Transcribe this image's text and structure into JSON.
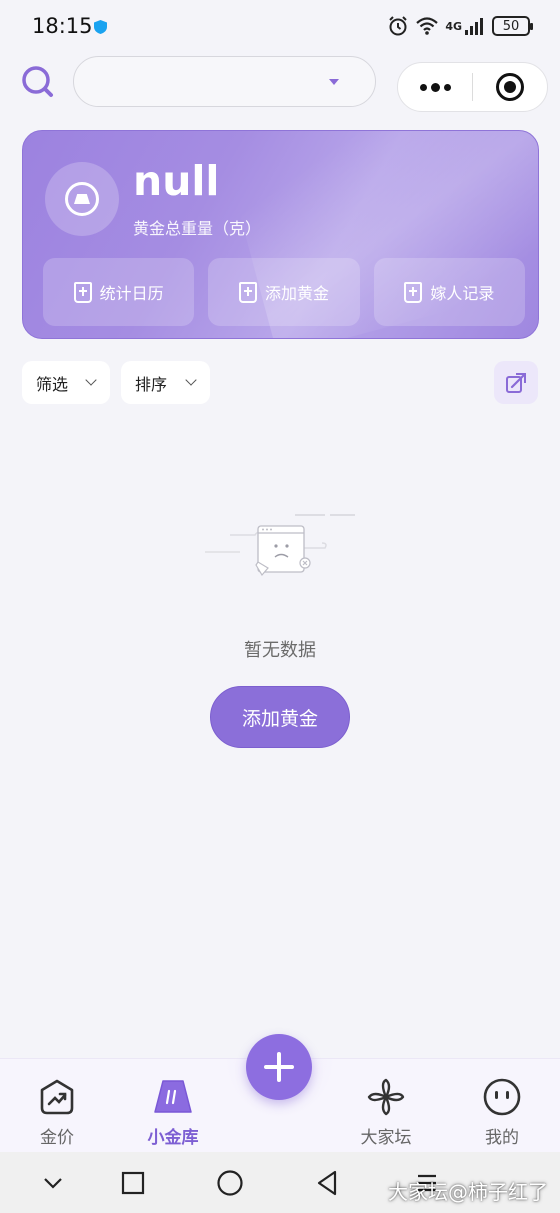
{
  "status_bar": {
    "time": "18:15",
    "network": "4G",
    "battery": "50"
  },
  "header": {
    "select_value": "",
    "icons": [
      "search-icon",
      "more-icon",
      "target-icon"
    ]
  },
  "summary": {
    "total_value": "null",
    "total_label": "黄金总重量（克）",
    "actions": [
      {
        "label": "统计日历",
        "icon": "calendar-plus-icon"
      },
      {
        "label": "添加黄金",
        "icon": "add-doc-icon"
      },
      {
        "label": "嫁人记录",
        "icon": "record-icon"
      }
    ],
    "accent_color": "#9c82e0"
  },
  "filters": {
    "filter_label": "筛选",
    "sort_label": "排序"
  },
  "empty_state": {
    "message": "暂无数据",
    "button_label": "添加黄金"
  },
  "bottom_nav": {
    "items": [
      {
        "label": "金价",
        "icon": "trend-icon"
      },
      {
        "label": "小金库",
        "icon": "gold-bar-icon"
      },
      {
        "label": "大家坛",
        "icon": "pinwheel-icon"
      },
      {
        "label": "我的",
        "icon": "face-icon"
      }
    ],
    "active_color": "#7d5fd3"
  },
  "watermark": "大家坛@柿子红了"
}
